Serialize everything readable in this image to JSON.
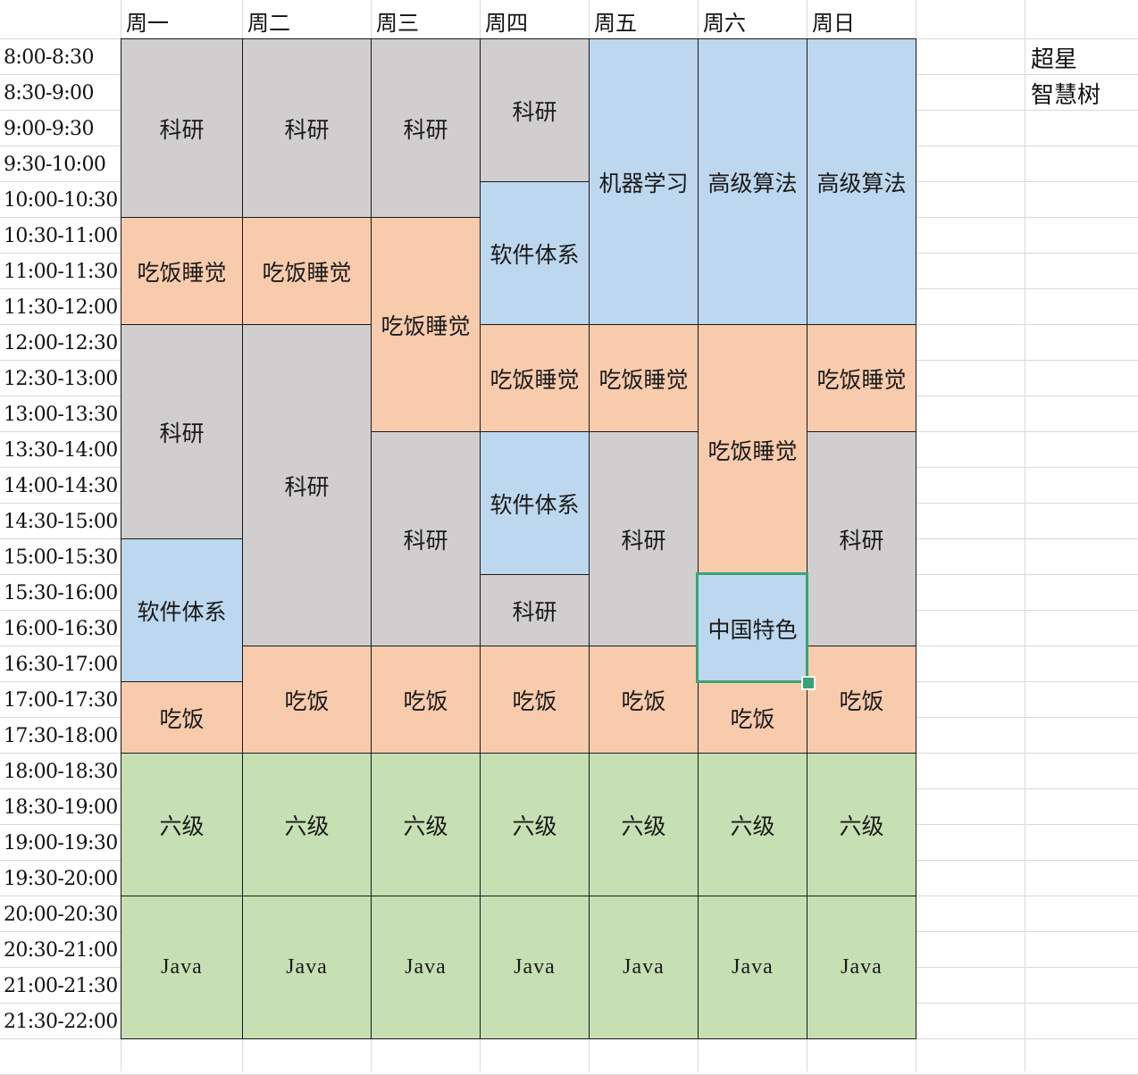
{
  "colors": {
    "gray": "#d0cece",
    "peach": "#f8cbad",
    "blue": "#bdd7ee",
    "green": "#c6e0b4",
    "selection": "#3aa276"
  },
  "days": [
    "周一",
    "周二",
    "周三",
    "周四",
    "周五",
    "周六",
    "周日"
  ],
  "times": [
    "8:00-8:30",
    "8:30-9:00",
    "9:00-9:30",
    "9:30-10:00",
    "10:00-10:30",
    "10:30-11:00",
    "11:00-11:30",
    "11:30-12:00",
    "12:00-12:30",
    "12:30-13:00",
    "13:00-13:30",
    "13:30-14:00",
    "14:00-14:30",
    "14:30-15:00",
    "15:00-15:30",
    "15:30-16:00",
    "16:00-16:30",
    "16:30-17:00",
    "17:00-17:30",
    "17:30-18:00",
    "18:00-18:30",
    "18:30-19:00",
    "19:00-19:30",
    "19:30-20:00",
    "20:00-20:30",
    "20:30-21:00",
    "21:00-21:30",
    "21:30-22:00"
  ],
  "schedule": [
    [
      {
        "label": "科研",
        "slots": 5,
        "color": "gray"
      },
      {
        "label": "吃饭睡觉",
        "slots": 3,
        "color": "peach"
      },
      {
        "label": "科研",
        "slots": 6,
        "color": "gray"
      },
      {
        "label": "软件体系",
        "slots": 4,
        "color": "blue"
      },
      {
        "label": "吃饭",
        "slots": 2,
        "color": "peach"
      },
      {
        "label": "六级",
        "slots": 4,
        "color": "green"
      },
      {
        "label": "Java",
        "slots": 4,
        "color": "green"
      }
    ],
    [
      {
        "label": "科研",
        "slots": 5,
        "color": "gray"
      },
      {
        "label": "吃饭睡觉",
        "slots": 3,
        "color": "peach"
      },
      {
        "label": "科研",
        "slots": 9,
        "color": "gray"
      },
      {
        "label": "吃饭",
        "slots": 3,
        "color": "peach"
      },
      {
        "label": "六级",
        "slots": 4,
        "color": "green"
      },
      {
        "label": "Java",
        "slots": 4,
        "color": "green"
      }
    ],
    [
      {
        "label": "科研",
        "slots": 5,
        "color": "gray"
      },
      {
        "label": "吃饭睡觉",
        "slots": 6,
        "color": "peach"
      },
      {
        "label": "科研",
        "slots": 6,
        "color": "gray"
      },
      {
        "label": "吃饭",
        "slots": 3,
        "color": "peach"
      },
      {
        "label": "六级",
        "slots": 4,
        "color": "green"
      },
      {
        "label": "Java",
        "slots": 4,
        "color": "green"
      }
    ],
    [
      {
        "label": "科研",
        "slots": 4,
        "color": "gray"
      },
      {
        "label": "软件体系",
        "slots": 4,
        "color": "blue"
      },
      {
        "label": "吃饭睡觉",
        "slots": 3,
        "color": "peach"
      },
      {
        "label": "软件体系",
        "slots": 4,
        "color": "blue"
      },
      {
        "label": "科研",
        "slots": 2,
        "color": "gray"
      },
      {
        "label": "吃饭",
        "slots": 3,
        "color": "peach"
      },
      {
        "label": "六级",
        "slots": 4,
        "color": "green"
      },
      {
        "label": "Java",
        "slots": 4,
        "color": "green"
      }
    ],
    [
      {
        "label": "机器学习",
        "slots": 8,
        "color": "blue"
      },
      {
        "label": "吃饭睡觉",
        "slots": 3,
        "color": "peach"
      },
      {
        "label": "科研",
        "slots": 6,
        "color": "gray"
      },
      {
        "label": "吃饭",
        "slots": 3,
        "color": "peach"
      },
      {
        "label": "六级",
        "slots": 4,
        "color": "green"
      },
      {
        "label": "Java",
        "slots": 4,
        "color": "green"
      }
    ],
    [
      {
        "label": "高级算法",
        "slots": 8,
        "color": "blue"
      },
      {
        "label": "吃饭睡觉",
        "slots": 7,
        "color": "peach"
      },
      {
        "label": "中国特色",
        "slots": 3,
        "color": "blue",
        "selected": true
      },
      {
        "label": "吃饭",
        "slots": 2,
        "color": "peach"
      },
      {
        "label": "六级",
        "slots": 4,
        "color": "green"
      },
      {
        "label": "Java",
        "slots": 4,
        "color": "green"
      }
    ],
    [
      {
        "label": "高级算法",
        "slots": 8,
        "color": "blue"
      },
      {
        "label": "吃饭睡觉",
        "slots": 3,
        "color": "peach"
      },
      {
        "label": "科研",
        "slots": 6,
        "color": "gray"
      },
      {
        "label": "吃饭",
        "slots": 3,
        "color": "peach"
      },
      {
        "label": "六级",
        "slots": 4,
        "color": "green"
      },
      {
        "label": "Java",
        "slots": 4,
        "color": "green"
      }
    ]
  ],
  "side_notes": [
    "超星",
    "智慧树"
  ]
}
